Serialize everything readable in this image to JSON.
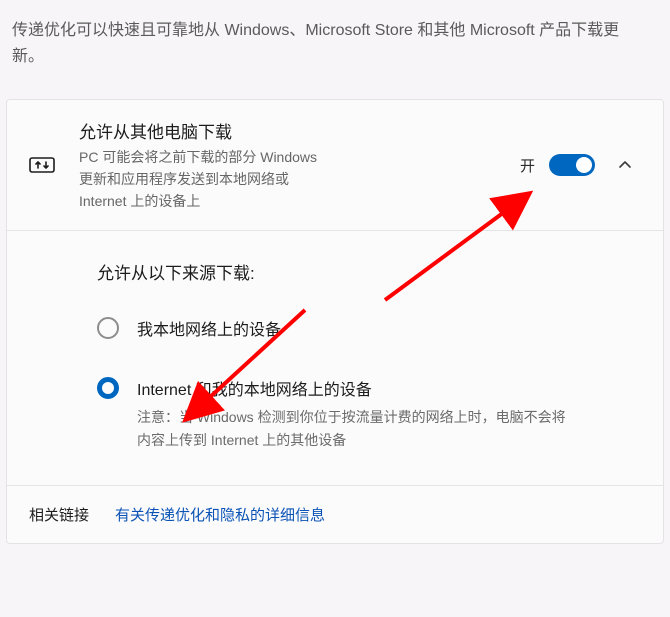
{
  "intro": "传递优化可以快速且可靠地从 Windows、Microsoft Store 和其他 Microsoft 产品下载更新。",
  "card": {
    "title": "允许从其他电脑下载",
    "subtitle": "PC 可能会将之前下载的部分 Windows 更新和应用程序发送到本地网络或 Internet 上的设备上",
    "toggle_label": "开",
    "toggle_on": true
  },
  "sources": {
    "heading": "允许从以下来源下载:",
    "options": [
      {
        "label": "我本地网络上的设备",
        "note": "",
        "selected": false
      },
      {
        "label": "Internet 和我的本地网络上的设备",
        "note": "注意：当 Windows 检测到你位于按流量计费的网络上时，电脑不会将内容上传到 Internet 上的其他设备",
        "selected": true
      }
    ]
  },
  "footer": {
    "title": "相关链接",
    "link": "有关传递优化和隐私的详细信息"
  }
}
